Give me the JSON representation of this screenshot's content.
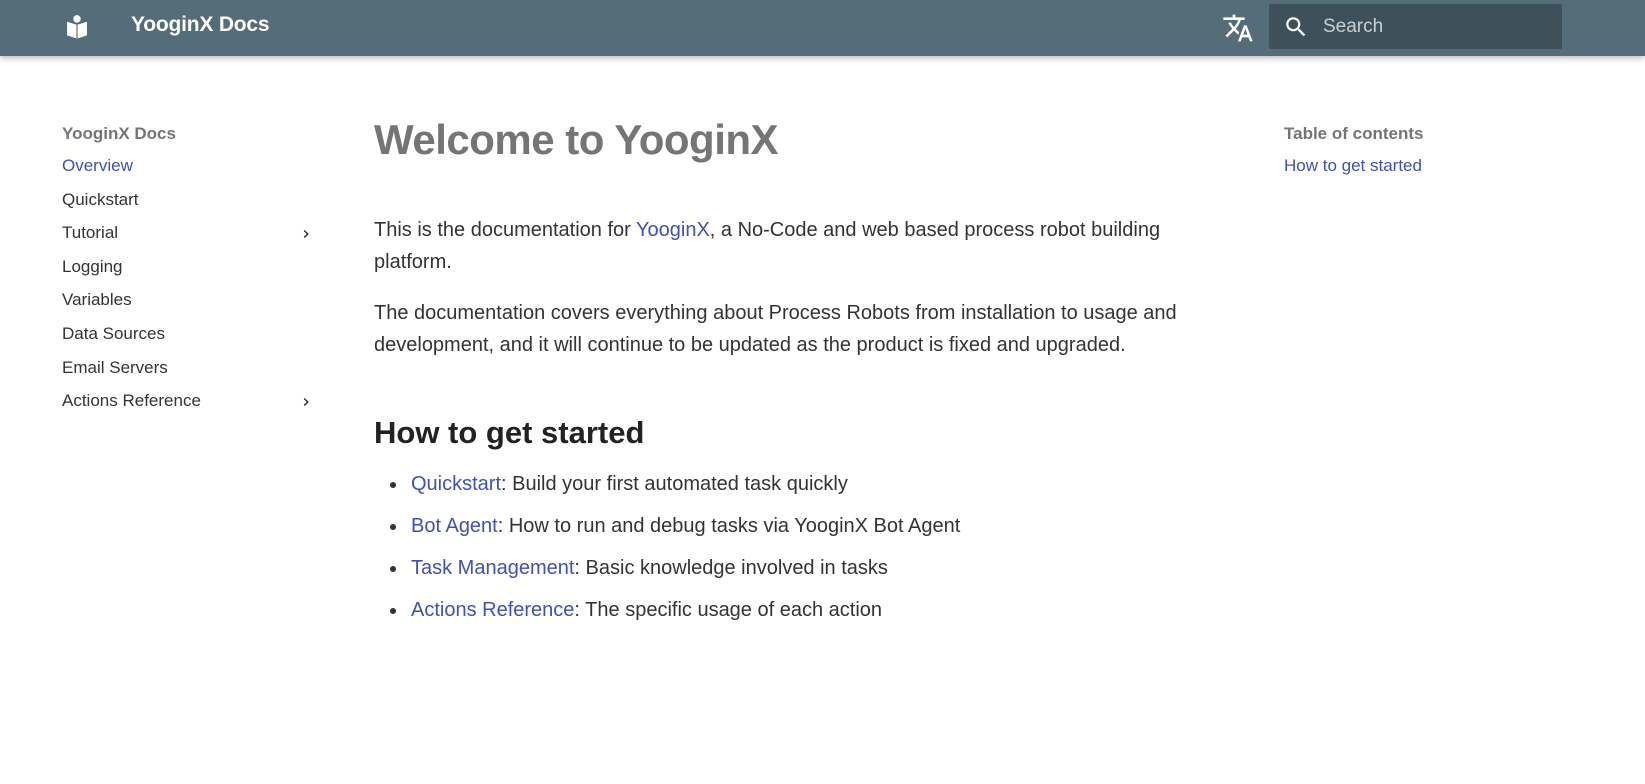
{
  "header": {
    "site_title": "YooginX Docs",
    "search_placeholder": "Search",
    "search_value": "",
    "logo_icon": "book-reader-icon",
    "translate_icon": "translate-icon",
    "search_icon": "magnifier-icon",
    "bar_color": "#546d78"
  },
  "sidebar": {
    "title": "YooginX Docs",
    "items": [
      {
        "label": "Overview",
        "active": true
      },
      {
        "label": "Quickstart"
      },
      {
        "label": "Tutorial",
        "expandable": true
      },
      {
        "label": "Logging"
      },
      {
        "label": "Variables"
      },
      {
        "label": "Data Sources"
      },
      {
        "label": "Email Servers"
      },
      {
        "label": "Actions Reference",
        "expandable": true
      }
    ]
  },
  "main": {
    "title": "Welcome to YooginX",
    "intro": {
      "before": "This is the documentation for ",
      "link": "YooginX",
      "after": ", a No-Code and web based process robot building platform."
    },
    "paragraph2": "The documentation covers everything about Process Robots from installation to usage and development, and it will continue to be updated as the product is fixed and upgraded.",
    "section_heading": "How to get started",
    "list": [
      {
        "link": "Quickstart",
        "text": ": Build your first automated task quickly"
      },
      {
        "link": "Bot Agent",
        "text": ": How to run and debug tasks via YooginX Bot Agent"
      },
      {
        "link": "Task Management",
        "text": ": Basic knowledge involved in tasks"
      },
      {
        "link": "Actions Reference",
        "text": ": The specific usage of each action"
      }
    ]
  },
  "toc": {
    "title": "Table of contents",
    "items": [
      "How to get started"
    ]
  },
  "colors": {
    "link": "#3f51b5",
    "muted": "#757575"
  }
}
